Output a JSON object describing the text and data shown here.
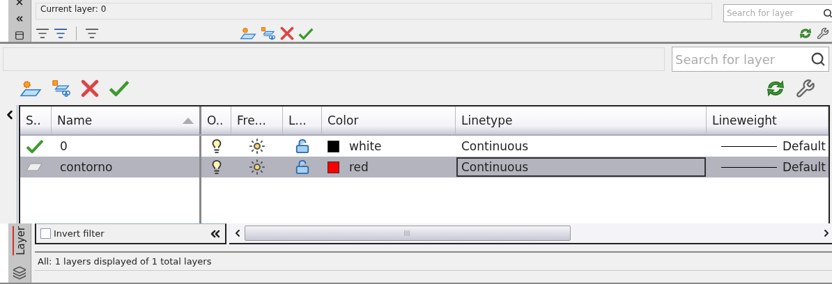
{
  "top_panel": {
    "current_layer": "Current layer: 0",
    "search": {
      "placeholder": "Search for layer"
    }
  },
  "main_panel": {
    "search": {
      "placeholder": "Search for layer"
    },
    "columns": [
      {
        "label": "S..",
        "sorted": false
      },
      {
        "label": "Name",
        "sorted": true
      },
      {
        "label": "O..",
        "sorted": false
      },
      {
        "label": "Fre...",
        "sorted": false
      },
      {
        "label": "L...",
        "sorted": false
      },
      {
        "label": "Color",
        "sorted": false
      },
      {
        "label": "Linetype",
        "sorted": false
      },
      {
        "label": "Lineweight",
        "sorted": false
      }
    ],
    "rows": [
      {
        "current": true,
        "name": "0",
        "on": true,
        "frozen": false,
        "locked": false,
        "color": "#000000",
        "color_name": "white",
        "linetype": "Continuous",
        "lineweight": "Default",
        "selected": false
      },
      {
        "current": false,
        "name": "contorno",
        "on": true,
        "frozen": false,
        "locked": false,
        "color": "#ff0000",
        "color_name": "red",
        "linetype": "Continuous",
        "lineweight": "Default",
        "selected": true
      }
    ]
  },
  "bottom_panel": {
    "tab_label": "Layer",
    "invert_filter": {
      "label": "Invert filter",
      "checked": false
    },
    "status": "All: 1 layers displayed of 1 total layers"
  }
}
